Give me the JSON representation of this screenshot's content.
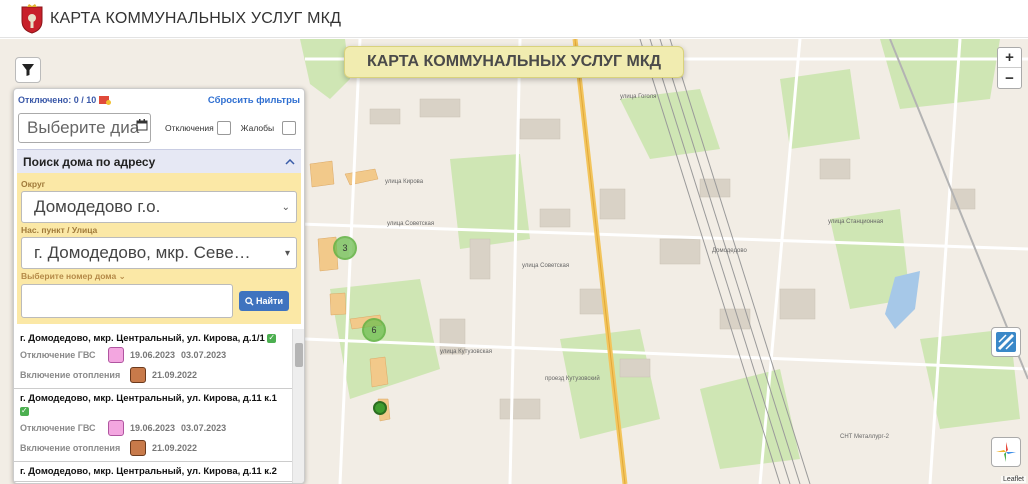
{
  "header": {
    "title": "КАРТА КОММУНАЛЬНЫХ УСЛУГ МКД"
  },
  "map": {
    "banner": "КАРТА КОММУНАЛЬНЫХ УСЛУГ МКД",
    "zoom_in": "+",
    "zoom_out": "−",
    "attribution": "Leaflet",
    "clusters": [
      "3",
      "6"
    ],
    "labels": [
      "улица Советская",
      "улица Советская",
      "улица Кирова",
      "улица Кутузовская",
      "проезд Кутузовский",
      "улица Станционная",
      "улица Гоголя",
      "СНТ Металлург-2",
      "Домодедово"
    ]
  },
  "panel": {
    "off_count": "Отключено: 0 / 10",
    "reset_filters": "Сбросить фильтры",
    "date_placeholder": "Выберите диа",
    "outages_label": "Отключения",
    "complaints_label": "Жалобы",
    "search_title": "Поиск дома по адресу",
    "district_label": "Округ",
    "district_value": "Домодедово г.о.",
    "street_label": "Нас. пункт / Улица",
    "street_value": "г. Домодедово, мкр. Севе…",
    "house_label": "Выберите номер дома",
    "find_button": "Найти"
  },
  "results": [
    {
      "address": "г. Домодедово, мкр. Центральный, ул. Кирова, д.1/1",
      "gvs_label": "Отключение ГВС",
      "gvs_from": "19.06.2023",
      "gvs_to": "03.07.2023",
      "heat_label": "Включение отопления",
      "heat_date": "21.09.2022"
    },
    {
      "address": "г. Домодедово, мкр. Центральный, ул. Кирова, д.11 к.1",
      "gvs_label": "Отключение ГВС",
      "gvs_from": "19.06.2023",
      "gvs_to": "03.07.2023",
      "heat_label": "Включение отопления",
      "heat_date": "21.09.2022"
    },
    {
      "address": "г. Домодедово, мкр. Центральный, ул. Кирова, д.11 к.2"
    }
  ]
}
